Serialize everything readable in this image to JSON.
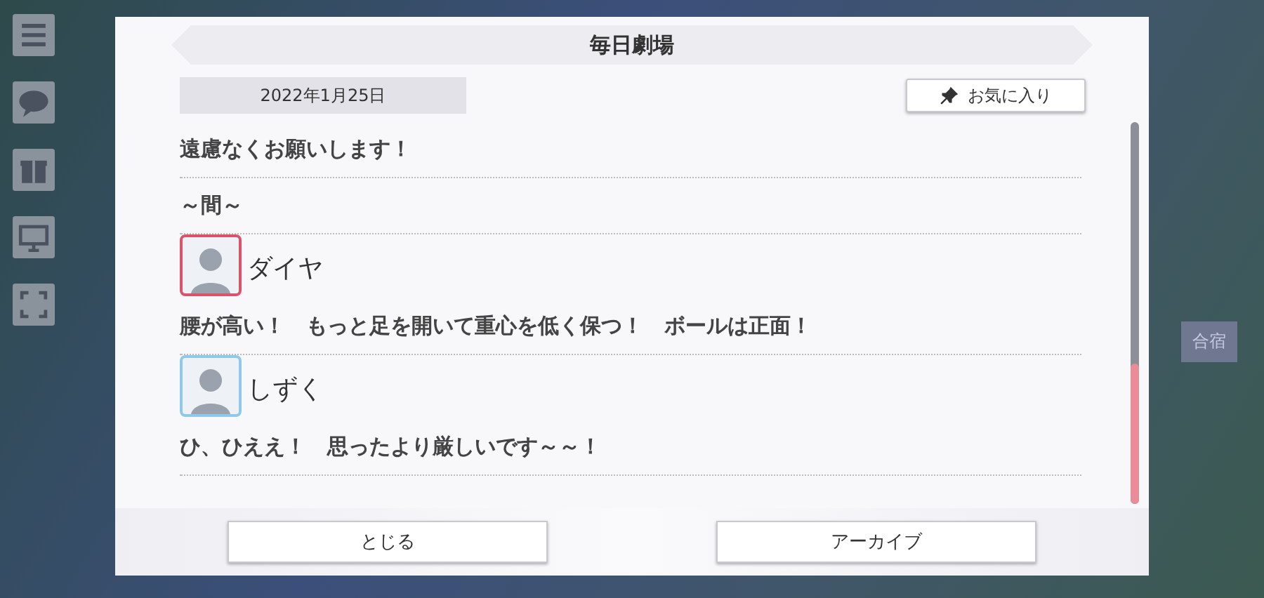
{
  "background": {
    "tile_label": "合宿"
  },
  "dialog": {
    "title": "毎日劇場",
    "date": "2022年1月25日",
    "favorite_button": "お気に入り",
    "entries": [
      {
        "kind": "line",
        "text": "遠慮なくお願いします！"
      },
      {
        "kind": "line",
        "text": "～間～"
      },
      {
        "kind": "speaker",
        "name": "ダイヤ",
        "color": "#d9536b"
      },
      {
        "kind": "line",
        "text": "腰が高い！　もっと足を開いて重心を低く保つ！　ボールは正面！"
      },
      {
        "kind": "speaker",
        "name": "しずく",
        "color": "#8fc8e8"
      },
      {
        "kind": "line",
        "text": "ひ、ひええ！　思ったより厳しいです～～！"
      }
    ],
    "buttons": [
      "とじる",
      "アーカイブ"
    ]
  }
}
